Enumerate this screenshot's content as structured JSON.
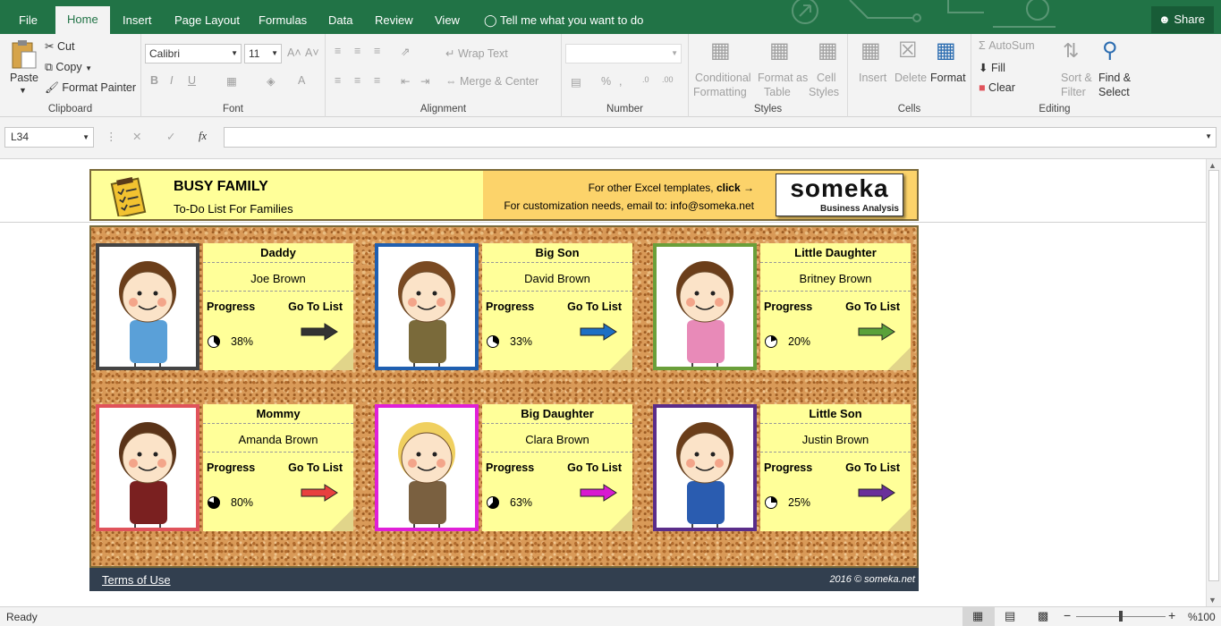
{
  "tabs": [
    "File",
    "Home",
    "Insert",
    "Page Layout",
    "Formulas",
    "Data",
    "Review",
    "View"
  ],
  "tell_me": "Tell me what you want to do",
  "share": "Share",
  "clipboard": {
    "paste": "Paste",
    "cut": "Cut",
    "copy": "Copy",
    "format_painter": "Format Painter",
    "label": "Clipboard"
  },
  "font": {
    "name": "Calibri",
    "size": "11",
    "bold": "B",
    "italic": "I",
    "underline": "U",
    "label": "Font"
  },
  "alignment": {
    "wrap": "Wrap Text",
    "merge": "Merge & Center",
    "label": "Alignment"
  },
  "number": {
    "percent": "%",
    "label": "Number"
  },
  "styles": {
    "cond1": "Conditional",
    "cond2": "Formatting",
    "fmt1": "Format as",
    "fmt2": "Table",
    "cell1": "Cell",
    "cell2": "Styles",
    "label": "Styles"
  },
  "cells": {
    "insert": "Insert",
    "delete": "Delete",
    "format": "Format",
    "label": "Cells"
  },
  "editing": {
    "autosum": "AutoSum",
    "fill": "Fill",
    "clear": "Clear",
    "sort1": "Sort &",
    "sort2": "Filter",
    "find1": "Find &",
    "find2": "Select",
    "label": "Editing"
  },
  "namebox": "L34",
  "fx": "fx",
  "banner": {
    "title": "BUSY FAMILY",
    "subtitle": "To-Do List For Families",
    "line1": "For other Excel templates, ",
    "line1b": "click →",
    "line2": "For customization needs, email to: info@someka.net",
    "logo": "someka",
    "logo_sub": "Business Analysis"
  },
  "members": [
    {
      "role": "Daddy",
      "name": "Joe Brown",
      "progress_label": "Progress",
      "goto": "Go To List",
      "pct": "38%",
      "pct_value": 0.38,
      "color": "#444444",
      "arrow": "#333333"
    },
    {
      "role": "Big Son",
      "name": "David Brown",
      "progress_label": "Progress",
      "goto": "Go To List",
      "pct": "33%",
      "pct_value": 0.33,
      "color": "#1f5fb0",
      "arrow": "#1e6fc4"
    },
    {
      "role": "Little Daughter",
      "name": "Britney Brown",
      "progress_label": "Progress",
      "goto": "Go To List",
      "pct": "20%",
      "pct_value": 0.2,
      "color": "#6a9f3a",
      "arrow": "#5aa13a"
    },
    {
      "role": "Mommy",
      "name": "Amanda Brown",
      "progress_label": "Progress",
      "goto": "Go To List",
      "pct": "80%",
      "pct_value": 0.8,
      "color": "#e0535b",
      "arrow": "#e8403e"
    },
    {
      "role": "Big Daughter",
      "name": "Clara Brown",
      "progress_label": "Progress",
      "goto": "Go To List",
      "pct": "63%",
      "pct_value": 0.63,
      "color": "#e020d8",
      "arrow": "#d81ad0"
    },
    {
      "role": "Little Son",
      "name": "Justin Brown",
      "progress_label": "Progress",
      "goto": "Go To List",
      "pct": "25%",
      "pct_value": 0.25,
      "color": "#5a2d8a",
      "arrow": "#6a2f9a"
    }
  ],
  "footer": {
    "terms": "Terms of Use",
    "copyright": "2016 © someka.net"
  },
  "status": {
    "ready": "Ready",
    "zoom": "%100"
  }
}
